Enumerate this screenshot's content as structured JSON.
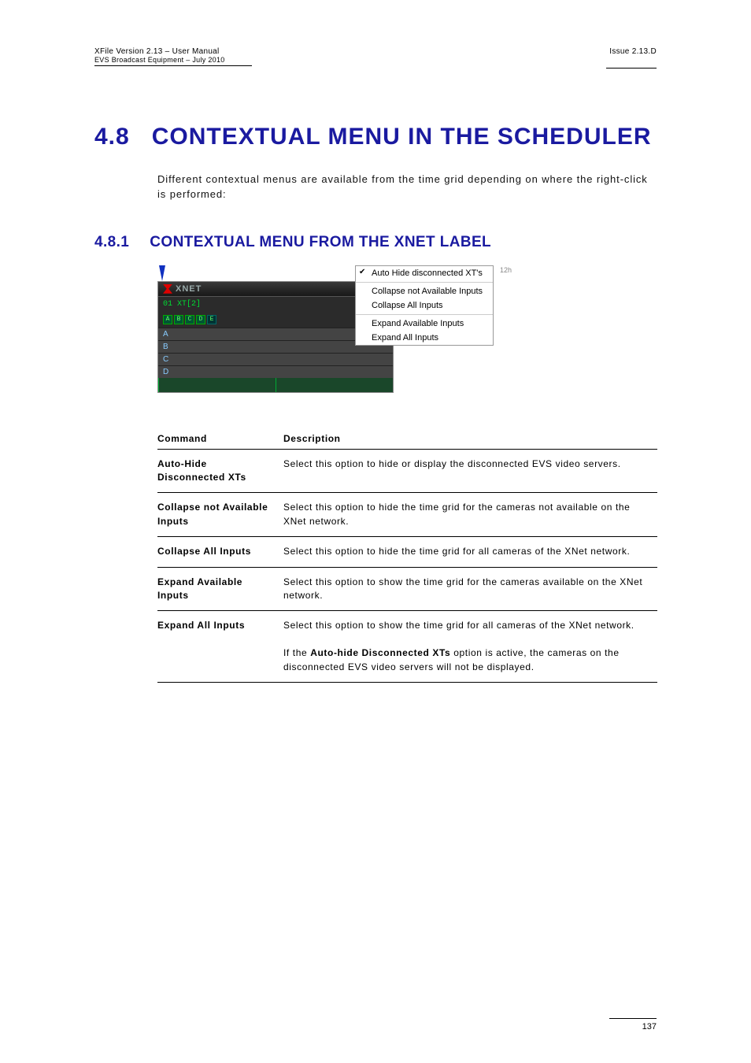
{
  "header": {
    "left_line1": "XFile Version 2.13 – User Manual",
    "left_line2": "EVS Broadcast Equipment – July 2010",
    "right": "Issue 2.13.D"
  },
  "title": {
    "num": "4.8",
    "text": "CONTEXTUAL MENU IN THE SCHEDULER"
  },
  "intro": "Different contextual menus are available from the time grid depending on where the right-click is performed:",
  "subtitle": {
    "num": "4.8.1",
    "text_pre": "C",
    "text_rest_1": "ontextual ",
    "text_M": "M",
    "text_rest_2": "enu from the ",
    "text_X": "X",
    "text_N": "N",
    "text_rest_3": "et ",
    "text_L": "L",
    "text_rest_4": "abel"
  },
  "subtitle_full": "CONTEXTUAL MENU FROM THE XNET LABEL",
  "screenshot": {
    "top_label": "XNET",
    "server": "01 XT[2]",
    "boxes": [
      "A",
      "B",
      "C",
      "D",
      "E"
    ],
    "letters": [
      "A",
      "B",
      "C",
      "D"
    ],
    "menu": {
      "item1": "Auto Hide disconnected XT's",
      "item2": "Collapse not Available Inputs",
      "item3": "Collapse All Inputs",
      "item4": "Expand Available Inputs",
      "item5": "Expand All Inputs"
    },
    "twelve": "12h"
  },
  "table": {
    "headers": {
      "c1": "Command",
      "c2": "Description"
    },
    "rows": [
      {
        "cmd": "Auto-Hide Disconnected XTs",
        "desc": "Select this option to hide or display the disconnected EVS video servers."
      },
      {
        "cmd": "Collapse not Available Inputs",
        "desc": "Select this option to hide the time grid for the cameras not available on the XNet network."
      },
      {
        "cmd": "Collapse All Inputs",
        "desc": "Select this option to hide the time grid for all cameras of the XNet network."
      },
      {
        "cmd": "Expand Available Inputs",
        "desc": "Select this option to show the time grid for the cameras available on the XNet network."
      },
      {
        "cmd": "Expand All Inputs",
        "desc_p1": "Select this option to show the time grid for all cameras of the XNet network.",
        "desc_p2a": "If the ",
        "desc_bold": "Auto-hide Disconnected XTs",
        "desc_p2b": " option is active, the cameras on the disconnected EVS video servers  will not be displayed."
      }
    ]
  },
  "footer": {
    "page": "137"
  }
}
